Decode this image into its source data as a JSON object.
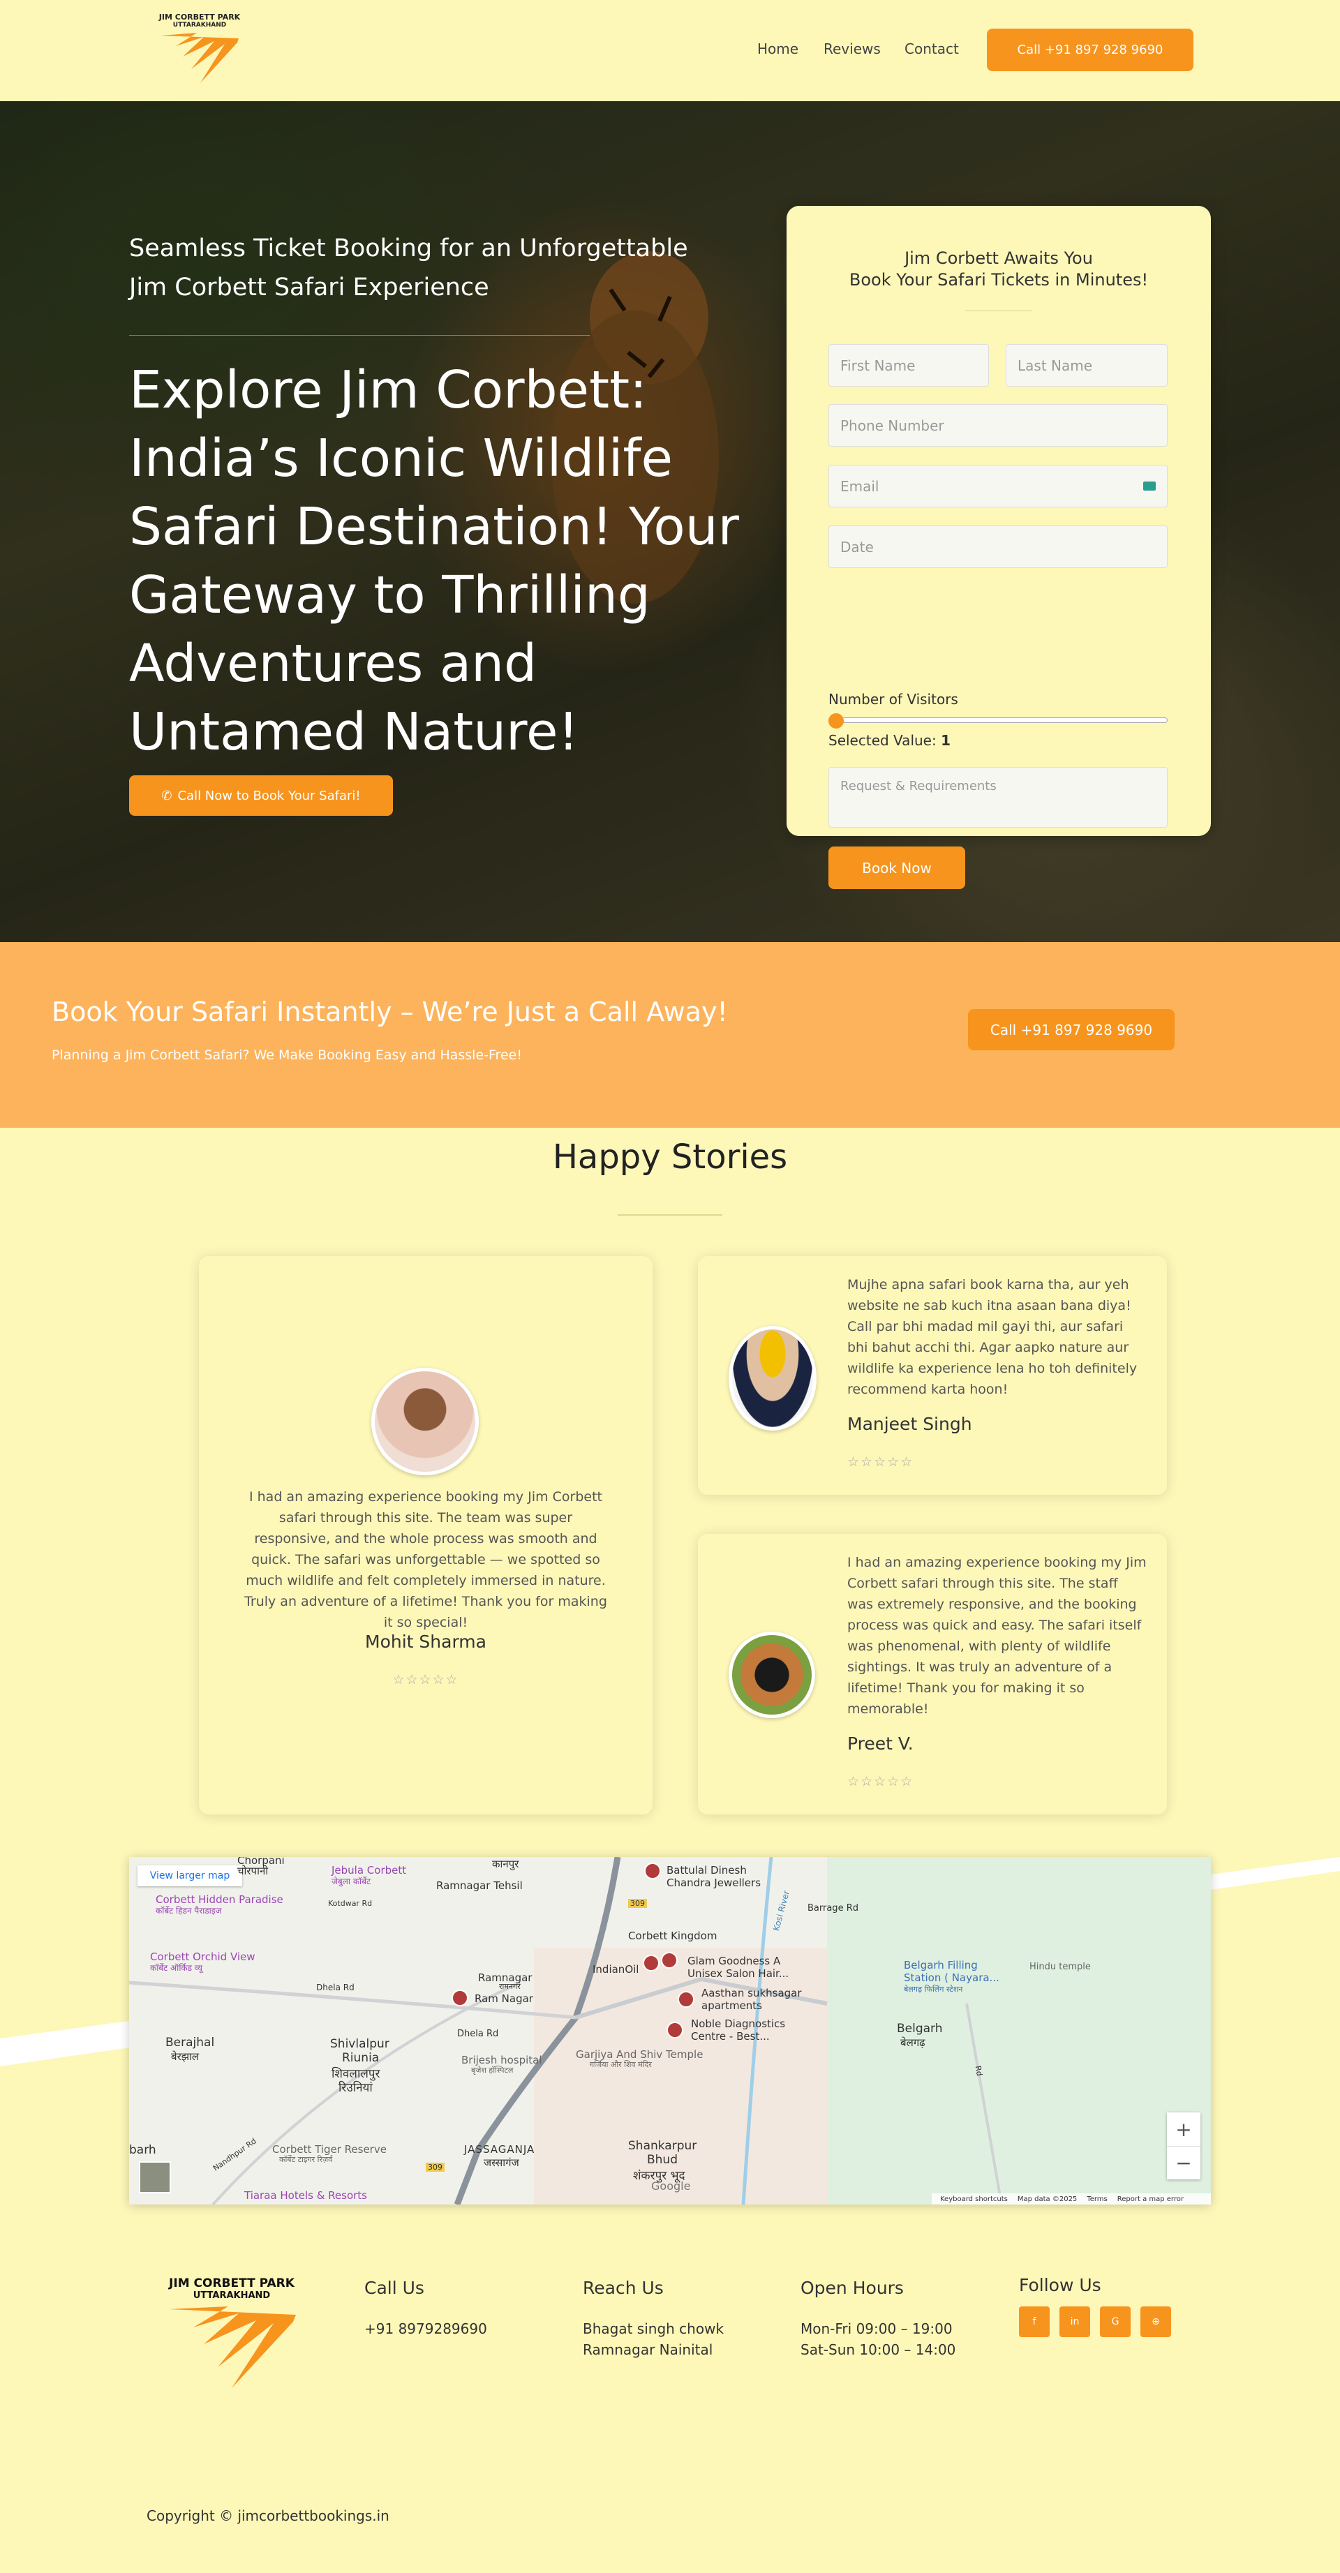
{
  "brand": {
    "logo_line1": "JIM CORBETT PARK",
    "logo_line2": "UTTARAKHAND",
    "accent": "#f7941d",
    "background": "#fdf7b8"
  },
  "nav": {
    "items": [
      "Home",
      "Reviews",
      "Contact"
    ],
    "call_label": "Call +91 897 928 9690"
  },
  "hero": {
    "subtitle": "Seamless Ticket Booking for an Unforgettable Jim Corbett Safari Experience",
    "title": "Explore Jim Corbett: India’s Iconic Wildlife Safari Destination! Your Gateway to Thrilling Adventures and Untamed Nature!",
    "cta_label": "Call Now to Book Your Safari!",
    "cta_icon": "phone-icon"
  },
  "form": {
    "title_line1": "Jim Corbett Awaits You",
    "title_line2": "Book Your Safari Tickets in Minutes!",
    "first_name": "First Name",
    "last_name": "Last Name",
    "phone": "Phone Number",
    "email": "Email",
    "date": "Date",
    "visitors_label": "Number of Visitors",
    "selected_label": "Selected Value:",
    "selected_value": "1",
    "visitors_fraction": 0,
    "requests": "Request & Requirements",
    "submit": "Book Now"
  },
  "band": {
    "title": "Book Your Safari Instantly – We’re Just a Call Away!",
    "subtitle": "Planning a Jim Corbett Safari? We Make Booking Easy and Hassle-Free!",
    "button": "Call +91 897 928 9690"
  },
  "stories": {
    "title": "Happy Stories",
    "items": [
      {
        "text": "I had an amazing experience booking my Jim Corbett safari through this site. The team was super responsive, and the whole process was smooth and quick. The safari was unforgettable — we spotted so much wildlife and felt completely immersed in nature. Truly an adventure of a lifetime! Thank you for making it so special!",
        "name": "Mohit Sharma",
        "stars": "☆☆☆☆☆"
      },
      {
        "text": "Mujhe apna safari book karna tha, aur yeh website ne sab kuch itna asaan bana diya! Call par bhi madad mil gayi thi, aur safari bhi bahut acchi thi. Agar aapko nature aur wildlife ka experience lena ho toh definitely recommend karta hoon!",
        "name": "Manjeet Singh",
        "stars": "☆☆☆☆☆"
      },
      {
        "text": "I had an amazing experience booking my Jim Corbett safari through this site. The staff was extremely responsive, and the booking process was quick and easy. The safari itself was phenomenal, with plenty of wildlife sightings. It was truly an adventure of a lifetime! Thank you for making it so memorable!",
        "name": "Preet V.",
        "stars": "☆☆☆☆☆"
      }
    ]
  },
  "map": {
    "view_larger": "View larger map",
    "labels": {
      "chorpani": "Chorpani",
      "chorpani_hi": "चोरपानी",
      "kanpur": "कानपुर",
      "jebula": "Jebula Corbett",
      "jebula_hi": "जेबुला कॉर्बेट",
      "tehsil": "Ramnagar Tehsil",
      "hidden": "Corbett Hidden Paradise",
      "hidden_hi": "कॉर्बेट हिडन पैराडाइज",
      "battulal": "Battulal Dinesh",
      "battulal2": "Chandra Jewellers",
      "kingdom": "Corbett Kingdom",
      "road309": "309",
      "kosi": "Kosi River",
      "barrage": "Barrage Rd",
      "orchid": "Corbett Orchid View",
      "orchid_hi": "कॉर्बेट ऑर्किड व्यू",
      "dhela": "Dhela Rd",
      "dhela2": "Dhela Rd",
      "ramnagar": "Ramnagar",
      "ramnagar_hi": "रामनगर",
      "indianoil": "IndianOil",
      "glam": "Glam Goodness A",
      "glam2": "Unisex Salon Hair...",
      "aasthan": "Aasthan sukhsagar",
      "aasthan2": "apartments",
      "noble": "Noble Diagnostics",
      "noble2": "Centre - Best...",
      "ramnagar_stn": "Ram Nagar",
      "belgarh_fill": "Belgarh Filling",
      "belgarh_fill2": "Station ( Nayara...",
      "belgarh_fill3": "बेलगढ़ फिलिंग स्टेशन",
      "hindu": "Hindu temple",
      "berajhal": "Berajhal",
      "berajhal_hi": "बेरझाल",
      "shivlal": "Shivlalpur",
      "shivlal2": "Riunia",
      "shivlal_hi": "शिवलालपुर",
      "shivlal_hi2": "रिउनियां",
      "brijesh": "Brijesh hospital",
      "brijesh_hi": "बृजेश हॉस्पिटल",
      "garjiya": "Garjiya And Shiv Temple",
      "garjiya_hi": "गर्जिया और शिव मंदिर",
      "belgarh": "Belgarh",
      "belgarh_hi": "बेलगढ़",
      "tiger": "Corbett Tiger Reserve",
      "tiger_hi": "कॉर्बेट टाइगर रिज़र्व",
      "jassaganja": "JASSAGANJA",
      "jassaganja_hi": "जस्सागंज",
      "shankarpur": "Shankarpur",
      "shankarpur2": "Bhud",
      "shankarpur_hi": "शंकरपुर भूद",
      "barh": "barh",
      "tiaraa": "Tiaraa Hotels & Resorts",
      "nandpur": "Nandhpur Rd",
      "kotdwar": "Kotdwar Rd",
      "road309b": "309",
      "google": "Google",
      "rd": "Rd"
    },
    "zoom_in": "+",
    "zoom_out": "−",
    "footer": [
      "Keyboard shortcuts",
      "Map data ©2025",
      "Terms",
      "Report a map error"
    ]
  },
  "footer": {
    "logo_line1": "JIM CORBETT PARK",
    "logo_line2": "UTTARAKHAND",
    "call_head": "Call Us",
    "call_value": "+91 8979289690",
    "reach_head": "Reach Us",
    "reach_line1": "Bhagat singh chowk",
    "reach_line2": "Ramnagar Nainital",
    "hours_head": "Open Hours",
    "hours_line1": "Mon-Fri 09:00 – 19:00",
    "hours_line2": "Sat-Sun 10:00 – 14:00",
    "follow_head": "Follow Us",
    "social": [
      {
        "icon": "facebook-icon",
        "glyph": "f"
      },
      {
        "icon": "linkedin-icon",
        "glyph": "in"
      },
      {
        "icon": "google-icon",
        "glyph": "G"
      },
      {
        "icon": "tripadvisor-icon",
        "glyph": "⊕"
      }
    ],
    "copyright": "Copyright © jimcorbettbookings.in"
  }
}
